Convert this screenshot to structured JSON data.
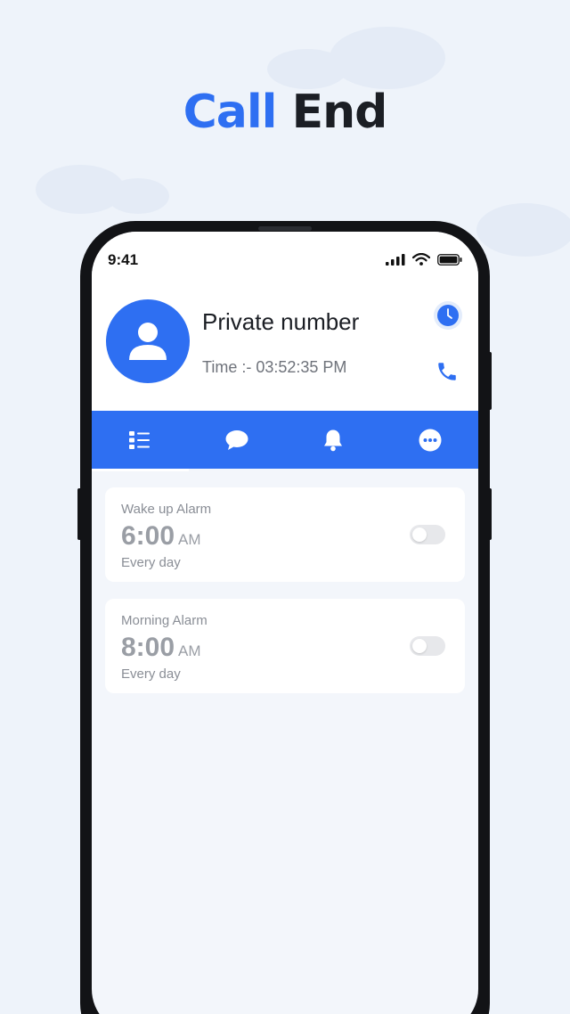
{
  "headline": {
    "accent_word": "Call",
    "dark_word": "End"
  },
  "status_bar": {
    "time": "9:41"
  },
  "caller": {
    "name": "Private number",
    "time_text": "Time :- 03:52:35 PM",
    "avatar_icon": "person-icon",
    "clock_icon": "clock-icon",
    "call_icon": "phone-icon"
  },
  "tabs": [
    {
      "icon": "list-icon",
      "active": true
    },
    {
      "icon": "chat-icon",
      "active": false
    },
    {
      "icon": "bell-icon",
      "active": false
    },
    {
      "icon": "more-icon",
      "active": false
    }
  ],
  "alarms": [
    {
      "label": "Wake up Alarm",
      "time": "6:00",
      "ampm": "AM",
      "repeat": "Every day",
      "enabled": false
    },
    {
      "label": "Morning Alarm",
      "time": "8:00",
      "ampm": "AM",
      "repeat": "Every day",
      "enabled": false
    }
  ],
  "colors": {
    "accent": "#2e6ff2",
    "background": "#eef3fa",
    "dark": "#1b1e24"
  }
}
